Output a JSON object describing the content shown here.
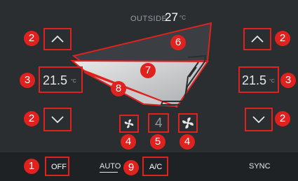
{
  "outside": {
    "label": "OUTSIDE",
    "value": "27",
    "unit": "°C"
  },
  "left_zone": {
    "temperature": "21.5",
    "unit": "°C"
  },
  "right_zone": {
    "temperature": "21.5",
    "unit": "°C"
  },
  "fan": {
    "speed": "4"
  },
  "bottom": {
    "off_label": "OFF",
    "auto_label": "AUTO",
    "ac_label": "A/C",
    "sync_label": "SYNC"
  },
  "callouts": {
    "off": "1",
    "left_up": "2",
    "left_down": "2",
    "right_up": "2",
    "right_down": "2",
    "left_temp": "3",
    "right_temp": "3",
    "fan_low": "4",
    "fan_high": "4",
    "fan_speed": "5",
    "airflow_zone": "6",
    "seat": "7",
    "footwell": "8",
    "ac": "9"
  },
  "icons": {
    "up": "chevron-up-icon",
    "down": "chevron-down-icon",
    "fan_low": "fan-low-icon",
    "fan_high": "fan-high-icon",
    "seat": "seat-icon"
  },
  "colors": {
    "background": "#2b2e31",
    "annotation": "#e0221f",
    "bottom_bar": "#1f2224",
    "text": "#e6e6e6"
  }
}
